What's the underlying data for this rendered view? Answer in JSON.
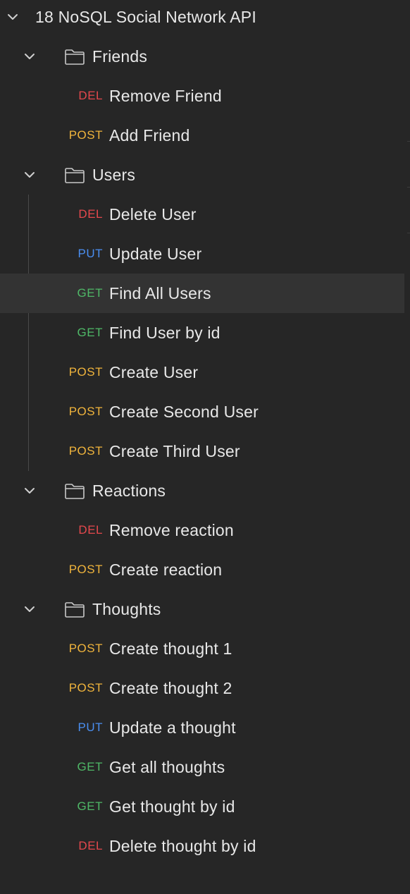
{
  "colors": {
    "DEL": "#e5484d",
    "POST": "#f0b43c",
    "PUT": "#4a8ef0",
    "GET": "#4fb867"
  },
  "collection": {
    "title": "18 NoSQL Social Network API",
    "expanded": true
  },
  "folders": [
    {
      "name": "Friends",
      "expanded": true,
      "requests": [
        {
          "method": "DEL",
          "name": "Remove Friend"
        },
        {
          "method": "POST",
          "name": "Add Friend"
        }
      ]
    },
    {
      "name": "Users",
      "expanded": true,
      "requests": [
        {
          "method": "DEL",
          "name": "Delete User"
        },
        {
          "method": "PUT",
          "name": "Update User"
        },
        {
          "method": "GET",
          "name": "Find All Users",
          "selected": true
        },
        {
          "method": "GET",
          "name": "Find User by id"
        },
        {
          "method": "POST",
          "name": "Create User"
        },
        {
          "method": "POST",
          "name": "Create Second User"
        },
        {
          "method": "POST",
          "name": "Create Third User"
        }
      ]
    },
    {
      "name": "Reactions",
      "expanded": true,
      "requests": [
        {
          "method": "DEL",
          "name": "Remove reaction"
        },
        {
          "method": "POST",
          "name": "Create reaction"
        }
      ]
    },
    {
      "name": "Thoughts",
      "expanded": true,
      "requests": [
        {
          "method": "POST",
          "name": "Create thought 1"
        },
        {
          "method": "POST",
          "name": "Create thought 2"
        },
        {
          "method": "PUT",
          "name": "Update a thought"
        },
        {
          "method": "GET",
          "name": "Get all thoughts"
        },
        {
          "method": "GET",
          "name": "Get thought by id"
        },
        {
          "method": "DEL",
          "name": "Delete thought by id"
        }
      ]
    }
  ]
}
